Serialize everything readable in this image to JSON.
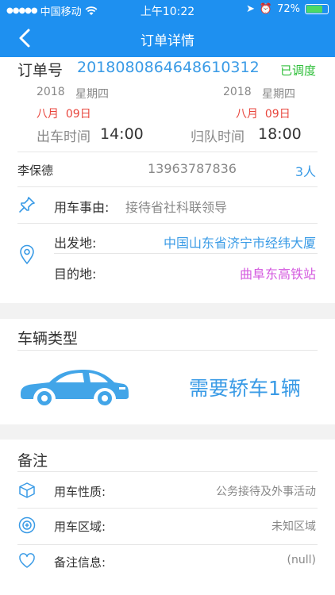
{
  "status_bar": {
    "carrier": "中国移动",
    "time": "上午10:22",
    "battery": "72%",
    "battery_level": 0.72
  },
  "nav": {
    "title": "订单详情",
    "back_icon": "chevron-left-icon"
  },
  "order": {
    "label": "订单号",
    "number": "2018080864648610312",
    "status": "已调度",
    "depart": {
      "year": "2018",
      "weekday": "星期四",
      "date": "八月  09日",
      "time_label": "出车时间",
      "time": "14:00"
    },
    "return": {
      "year": "2018",
      "weekday": "星期四",
      "date": "八月  09日",
      "time_label": "归队时间",
      "time": "18:00"
    },
    "contact_name": "李保德",
    "contact_phone": "13963787836",
    "passengers": "3人",
    "reason_label": "用车事由:",
    "reason": "接待省社科联领导",
    "from_label": "出发地:",
    "from": "中国山东省济宁市经纬大厦",
    "to_label": "目的地:",
    "to": "曲阜东高铁站"
  },
  "vehicle": {
    "section_title": "车辆类型",
    "need": "需要轿车1辆"
  },
  "remarks": {
    "section_title": "备注",
    "items": [
      {
        "icon": "cube-icon",
        "label": "用车性质:",
        "value": "公务接待及外事活动"
      },
      {
        "icon": "area-icon",
        "label": "用车区域:",
        "value": "未知区域"
      },
      {
        "icon": "heart-icon",
        "label": "备注信息:",
        "value": "(null)"
      }
    ]
  },
  "colors": {
    "primary": "#1e90f0",
    "link_blue": "#3a9be6",
    "red": "#e8453c",
    "green": "#2fbf3a",
    "purple": "#d45adf"
  }
}
